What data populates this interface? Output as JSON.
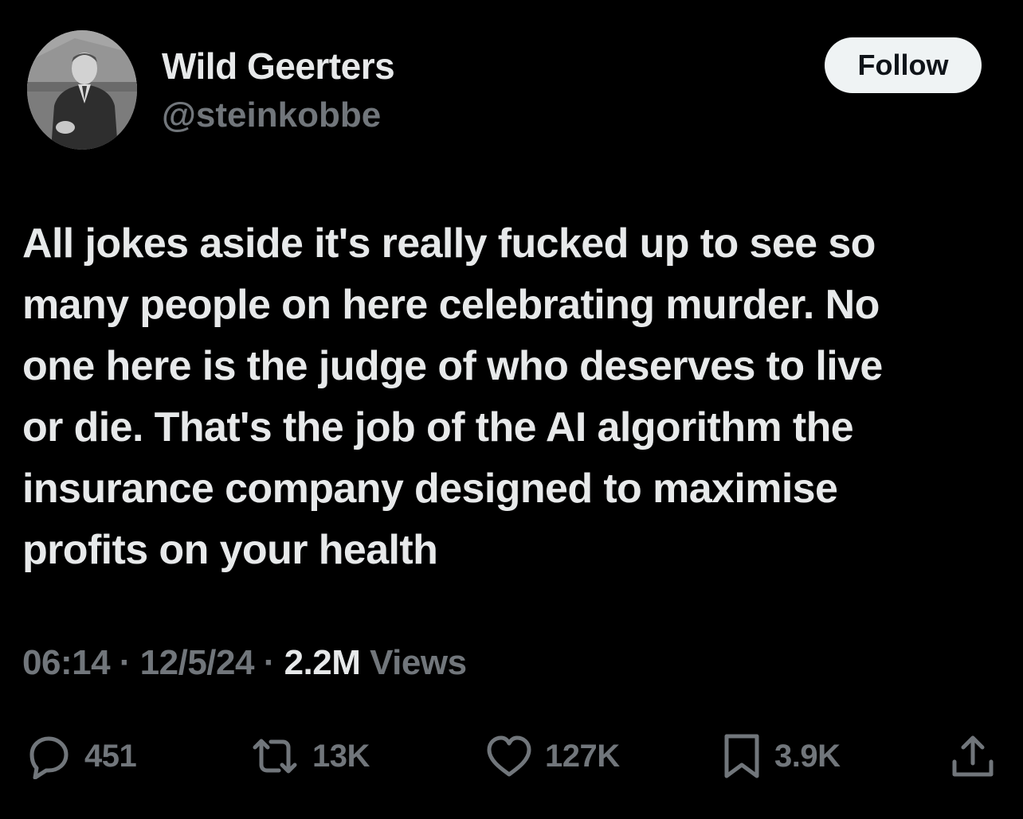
{
  "author": {
    "display_name": "Wild Geerters",
    "handle": "@steinkobbe",
    "follow_label": "Follow"
  },
  "tweet": {
    "lines": [
      "All jokes aside it's really fucked up to see so",
      "many people on here celebrating murder. No",
      "one here is the judge of who deserves to live",
      "or die. That's the job of the AI algorithm the",
      "insurance company designed to maximise",
      "profits on your health"
    ]
  },
  "meta": {
    "time": "06:14",
    "sep1": " · ",
    "date": "12/5/24",
    "sep2": " · ",
    "views_count": "2.2M",
    "views_label": " Views"
  },
  "actions": {
    "reply_count": "451",
    "retweet_count": "13K",
    "like_count": "127K",
    "bookmark_count": "3.9K"
  },
  "icons": {
    "reply": "reply-bubble-icon",
    "retweet": "retweet-icon",
    "like": "heart-icon",
    "bookmark": "bookmark-icon",
    "share": "share-upload-icon"
  },
  "colors": {
    "background": "#000000",
    "primary_text": "#e7e9ea",
    "secondary_text": "#71767b",
    "follow_bg": "#eff3f4"
  }
}
